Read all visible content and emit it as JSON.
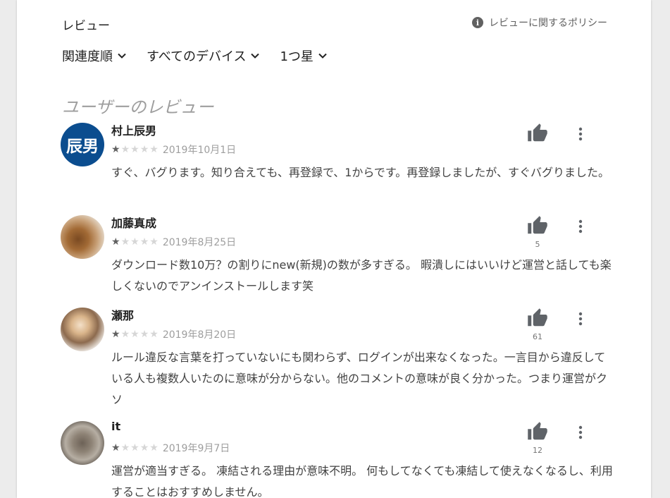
{
  "header": {
    "title": "レビュー",
    "policy_label": "レビューに関するポリシー",
    "info_icon": "info-icon"
  },
  "filters": [
    {
      "label": "関連度順"
    },
    {
      "label": "すべてのデバイス"
    },
    {
      "label": "1つ星"
    }
  ],
  "section_title": "ユーザーのレビュー",
  "reviews": [
    {
      "author": "村上辰男",
      "avatar_text": "辰男",
      "rating": 1,
      "date": "2019年10月1日",
      "text": "すぐ、バグります。知り合えても、再登録で、1からです。再登録しましたが、すぐバグりました。",
      "helpful_count": ""
    },
    {
      "author": "加藤真成",
      "avatar_text": "",
      "rating": 1,
      "date": "2019年8月25日",
      "text": "ダウンロード数10万？の割りにnew(新規)の数が多すぎる。 暇潰しにはいいけど運営と話しても楽しくないのでアンインストールします笑",
      "helpful_count": "5"
    },
    {
      "author": "瀬那",
      "avatar_text": "",
      "rating": 1,
      "date": "2019年8月20日",
      "text": "ルール違反な言葉を打っていないにも関わらず、ログインが出来なくなった。一言目から違反している人も複数人いたのに意味が分からない。他のコメントの意味が良く分かった。つまり運営がクソ",
      "helpful_count": "61"
    },
    {
      "author": "it",
      "avatar_text": "",
      "rating": 1,
      "date": "2019年9月7日",
      "text": "運営が適当すぎる。 凍結される理由が意味不明。 何もしてなくても凍結して使えなくなるし、利用することはおすすめしません。",
      "helpful_count": "12"
    }
  ],
  "icons": {
    "thumb": "thumbs-up-icon",
    "more": "more-vert-icon",
    "chevron": "chevron-down-icon"
  },
  "colors": {
    "avatar_bg": "#0b4d8f",
    "star_on": "#616161",
    "star_off": "#d6d6d6",
    "icon": "#5f6368"
  }
}
